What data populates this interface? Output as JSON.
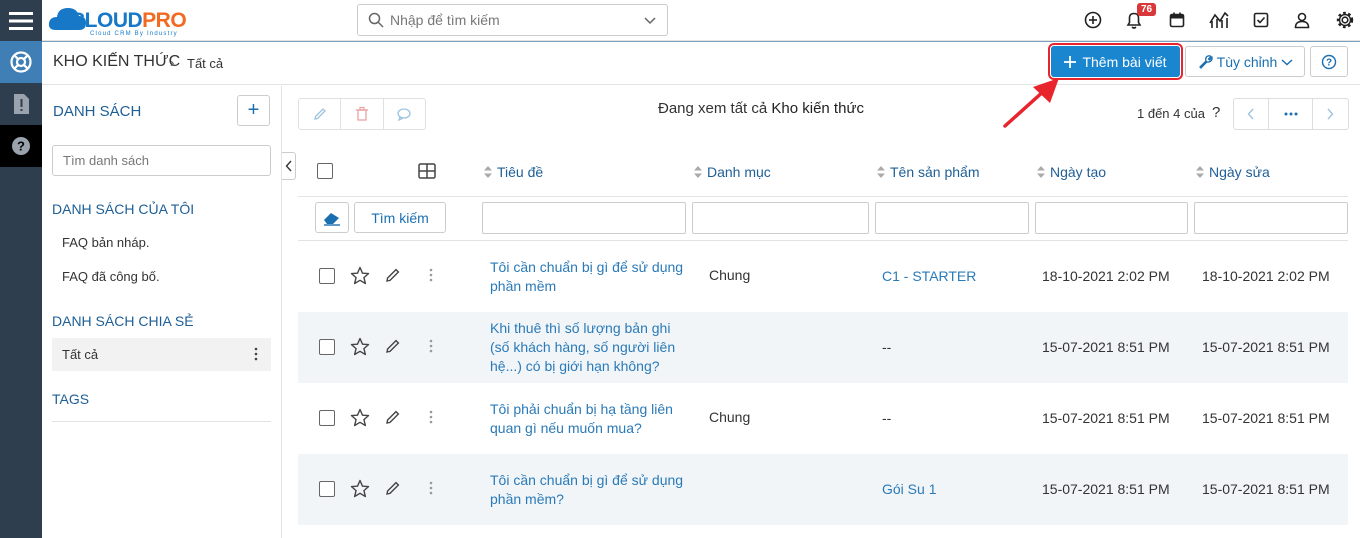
{
  "app": {
    "logo_main": "CLOUD",
    "logo_accent": "PRO",
    "logo_tagline": "Cloud CRM By Industry"
  },
  "search": {
    "placeholder": "Nhập để tìm kiếm"
  },
  "topbar": {
    "notification_count": "76"
  },
  "header": {
    "breadcrumb_module": "KHO KIẾN THỨC",
    "breadcrumb_sep": "›",
    "breadcrumb_current": "Tất cả",
    "add_button": "Thêm bài viết",
    "customize_button": "Tùy chỉnh"
  },
  "sidebar": {
    "title": "DANH SÁCH",
    "search_placeholder": "Tìm danh sách",
    "my_lists_title": "DANH SÁCH CỦA TÔI",
    "my_lists": [
      "FAQ bản nháp.",
      "FAQ đã công bố."
    ],
    "shared_title": "DANH SÁCH CHIA SẺ",
    "shared": [
      "Tất cả"
    ],
    "tags_title": "TAGS"
  },
  "main": {
    "viewing_prefix": "Đang xem tất cả",
    "viewing_module": "Kho kiến thức",
    "pagination": "1 đến 4 của",
    "pagination_q": "?",
    "search_button": "Tìm kiếm",
    "columns": [
      "Tiêu đề",
      "Danh mục",
      "Tên sản phẩm",
      "Ngày tạo",
      "Ngày sửa"
    ]
  },
  "rows": [
    {
      "title": [
        "Tôi cần chuẩn bị gì để sử dụng",
        "phần mềm"
      ],
      "category": "Chung",
      "product": "C1 - STARTER",
      "created": "18-10-2021 2:02 PM",
      "modified": "18-10-2021 2:02 PM"
    },
    {
      "title": [
        "Khi thuê thì số lượng bản ghi",
        "(số khách hàng, số người liên",
        "hệ...) có bị giới hạn không?"
      ],
      "category": "",
      "product": "--",
      "created": "15-07-2021 8:51 PM",
      "modified": "15-07-2021 8:51 PM"
    },
    {
      "title": [
        "Tôi phải chuẩn bị hạ tầng liên",
        "quan gì nếu muốn mua?"
      ],
      "category": "Chung",
      "product": "--",
      "created": "15-07-2021 8:51 PM",
      "modified": "15-07-2021 8:51 PM"
    },
    {
      "title": [
        "Tôi cần chuẩn bị gì để sử dụng",
        "phần mềm?"
      ],
      "category": "",
      "product": "Gói Su 1",
      "created": "15-07-2021 8:51 PM",
      "modified": "15-07-2021 8:51 PM"
    }
  ],
  "colors": {
    "rail": "#2e3e4e",
    "primary": "#1a86d0",
    "link": "#2a7ab8",
    "header_text": "#1e5f96",
    "alert": "#e8252d"
  }
}
